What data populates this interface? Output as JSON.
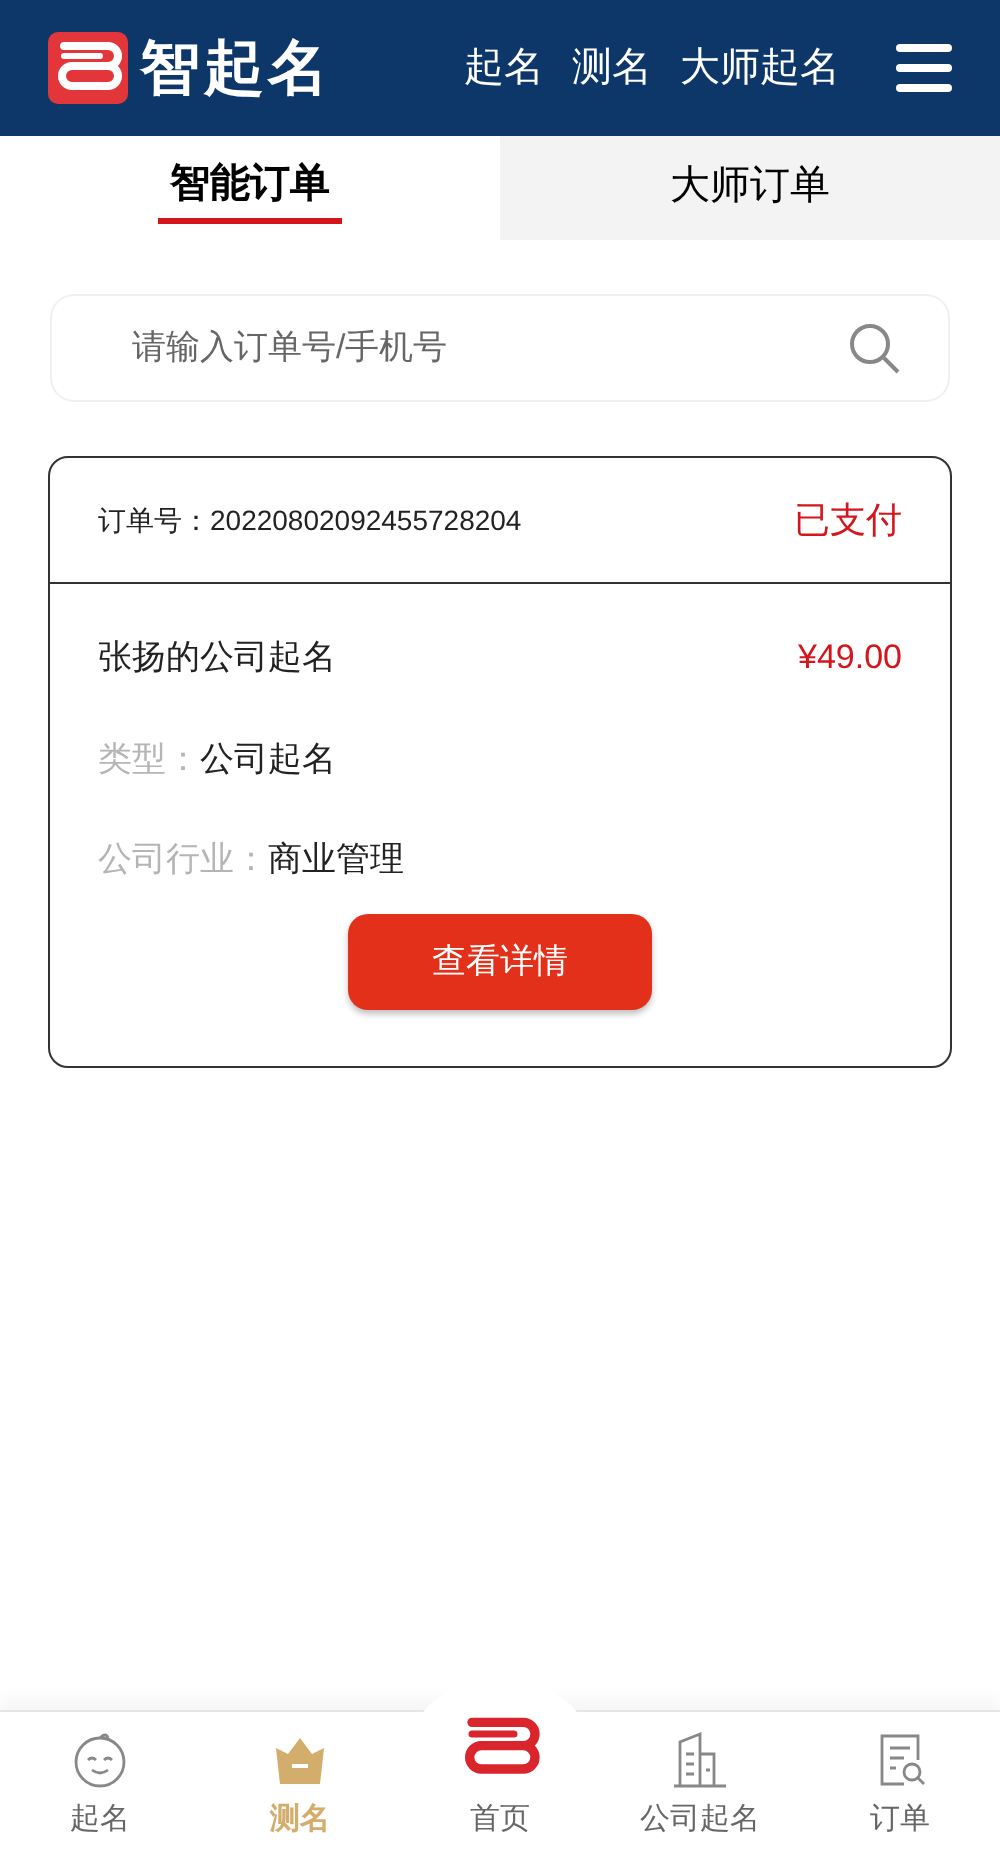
{
  "header": {
    "logo_text": "智起名",
    "nav": [
      "起名",
      "测名",
      "大师起名"
    ]
  },
  "tabs": [
    {
      "label": "智能订单",
      "selected": true
    },
    {
      "label": "大师订单",
      "selected": false
    }
  ],
  "search": {
    "placeholder": "请输入订单号/手机号"
  },
  "orders": [
    {
      "order_no": "订单号：20220802092455728204",
      "status": "已支付",
      "title": "张扬的公司起名",
      "price": "¥49.00",
      "fields": [
        {
          "label": "类型：",
          "value": "公司起名"
        },
        {
          "label": "公司行业：",
          "value": "商业管理"
        }
      ],
      "button": "查看详情"
    }
  ],
  "bottom_nav": [
    {
      "kind": "baby",
      "label": "起名",
      "selected": false
    },
    {
      "kind": "crown",
      "label": "测名",
      "selected": true
    },
    {
      "kind": "home",
      "label": "首页",
      "selected": false
    },
    {
      "kind": "building",
      "label": "公司起名",
      "selected": false
    },
    {
      "kind": "document",
      "label": "订单",
      "selected": false
    }
  ]
}
